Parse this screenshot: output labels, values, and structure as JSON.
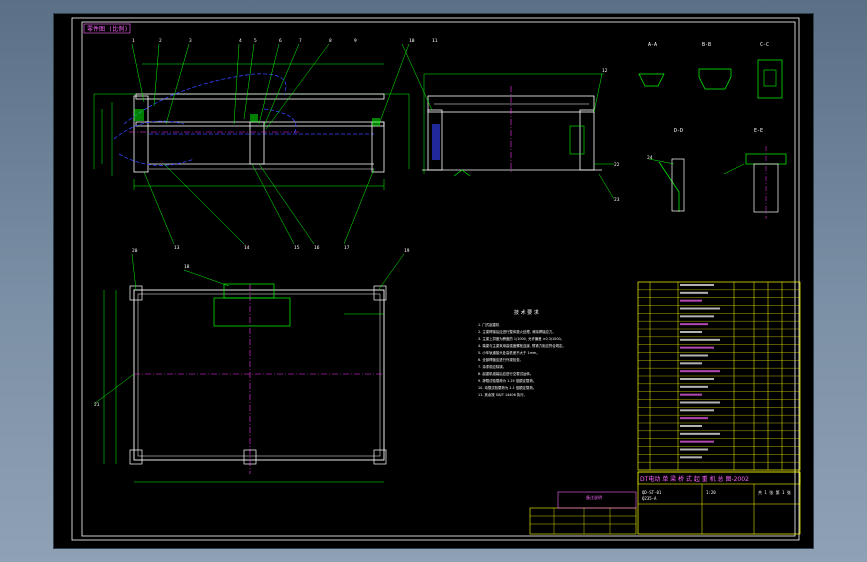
{
  "drawing": {
    "title_tag": "零件图 (比例)",
    "colors": {
      "background": "#000000",
      "frame": "#ffffff",
      "part_green": "#00ff00",
      "part_white": "#ffffff",
      "hidden_blue": "#3344ff",
      "centerline_magenta": "#ff33ff",
      "title_yellow": "#ffff00",
      "title_magenta": "#ff66ff"
    },
    "balloons": [
      "1",
      "2",
      "3",
      "4",
      "5",
      "6",
      "7",
      "8",
      "9",
      "10",
      "11",
      "12",
      "13",
      "14",
      "15",
      "16",
      "17",
      "18",
      "19",
      "20",
      "21",
      "22",
      "23",
      "24"
    ],
    "section_labels": [
      "A-A",
      "B-B",
      "C-C",
      "D-D",
      "E-E"
    ],
    "tech_requirements": {
      "heading": "技 术 要 求",
      "lines": [
        "1. 门式起重机",
        "2. 主梁焊接后应进行整体退火处理, 消除焊接应力。",
        "3. 主梁上拱度为跨度的 1/1000, 允许偏差 ±0.3/1000。",
        "4. 端梁与主梁采用高强度螺栓连接, 预紧力矩应符合规定。",
        "5. 小车轨道接头处高低差不大于 1mm。",
        "6. 全部焊缝应进行外观检查。",
        "7. 涂漆前应除锈。",
        "8. 起重机组装后应进行空载试运转。",
        "9. 静载试验载荷为 1.25 倍额定载荷。",
        "10. 动载试验载荷为 1.1 倍额定载荷。",
        "11. 其余按 GB/T 14406 执行。"
      ]
    },
    "title_block": {
      "main_title": "DT电动 单 梁 桥 式 起 重 机 总 图-2002",
      "part_no": "QD-ST-01",
      "material": "Q235-A",
      "scale": "1:20",
      "sheet": "共 1 张 第 1 张",
      "rows": 24
    },
    "notes_box": {
      "heading": "备注说明"
    }
  }
}
